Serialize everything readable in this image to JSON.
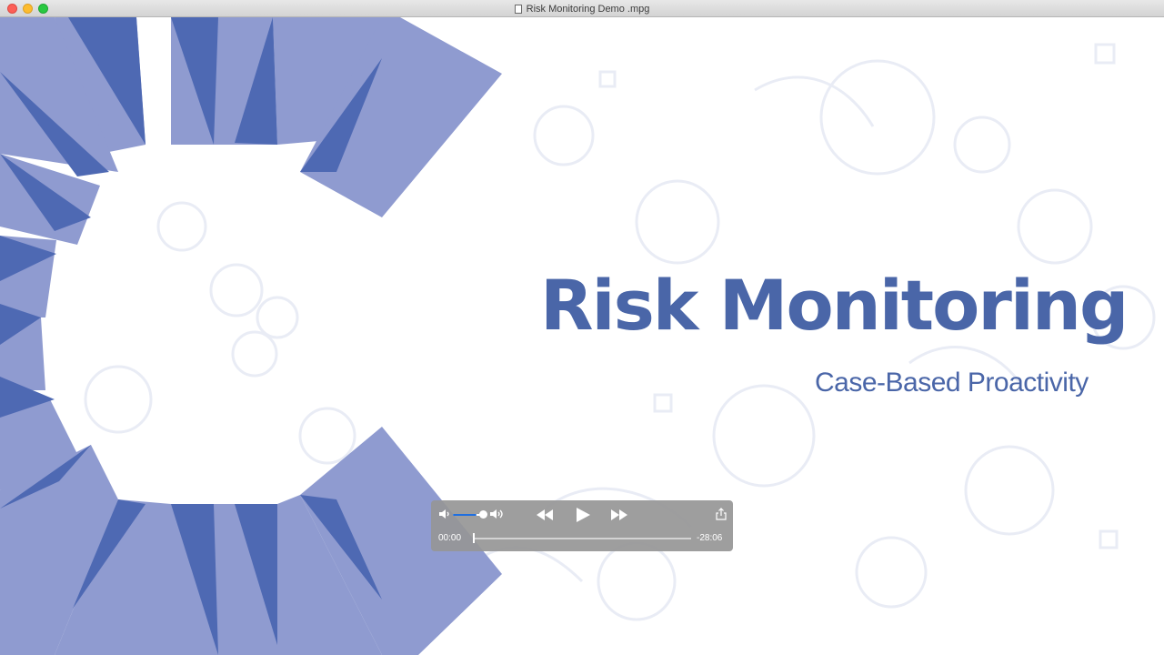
{
  "window": {
    "title": "Risk Monitoring Demo .mpg"
  },
  "slide": {
    "title": "Risk Monitoring",
    "subtitle": "Case-Based Proactivity",
    "colors": {
      "accent": "#4a66a8",
      "ray_light": "#8f9bd0",
      "ray_dark": "#4e69b3"
    }
  },
  "player": {
    "time_elapsed": "00:00",
    "time_remaining": "-28:06",
    "volume_fraction": 0.75,
    "progress_fraction": 0.0,
    "icons": [
      "volume-low-icon",
      "volume-high-icon",
      "rewind-icon",
      "play-icon",
      "fast-forward-icon",
      "share-icon"
    ]
  }
}
